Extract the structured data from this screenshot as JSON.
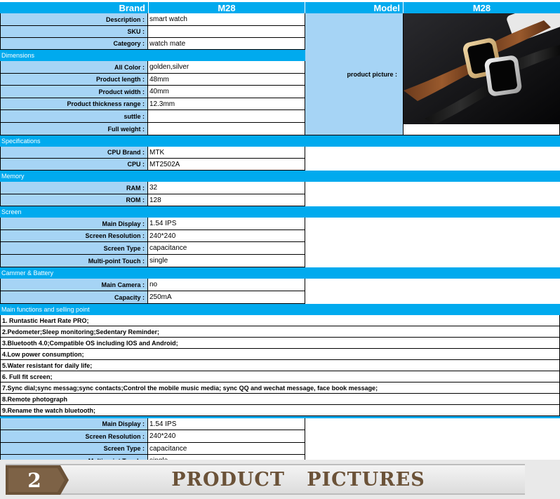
{
  "header": {
    "brand_label": "Brand",
    "brand_value": "M28",
    "model_label": "Model",
    "model_value": "M28"
  },
  "basic": [
    {
      "label": "Description :",
      "value": "smart watch"
    },
    {
      "label": "SKU :",
      "value": ""
    },
    {
      "label": "Category :",
      "value": "watch mate"
    }
  ],
  "picture_label": "product picture :",
  "sections": {
    "dimensions": "Dimensions",
    "specifications": "Specifications",
    "memory": "Memory",
    "screen": "Screen",
    "camera_battery": "Cammer & Battery",
    "main_functions": "Main functions and selling point"
  },
  "dimensions": [
    {
      "label": "All Color :",
      "value": "golden,silver"
    },
    {
      "label": "Product length :",
      "value": "48mm"
    },
    {
      "label": "Product width :",
      "value": "40mm"
    },
    {
      "label": "Product thickness range :",
      "value": "12.3mm"
    },
    {
      "label": "suttle :",
      "value": ""
    },
    {
      "label": "Full weight :",
      "value": ""
    }
  ],
  "specifications": [
    {
      "label": "CPU Brand :",
      "value": "MTK"
    },
    {
      "label": "CPU :",
      "value": "MT2502A"
    }
  ],
  "memory": [
    {
      "label": "RAM :",
      "value": "32"
    },
    {
      "label": "ROM :",
      "value": "128"
    }
  ],
  "screen": [
    {
      "label": "Main Display :",
      "value": "1.54 IPS"
    },
    {
      "label": "Screen Resolution :",
      "value": "240*240"
    },
    {
      "label": "Screen Type :",
      "value": "capacitance"
    },
    {
      "label": "Multi-point Touch :",
      "value": "single"
    }
  ],
  "camera_battery": [
    {
      "label": "Main Camera :",
      "value": "no"
    },
    {
      "label": "Capacity :",
      "value": "250mA"
    }
  ],
  "features": [
    "1. Runtastic Heart Rate PRO;",
    "2.Pedometer;Sleep monitoring;Sedentary Reminder;",
    "3.Bluetooth 4.0;Compatible OS including IOS and Android;",
    "4.Low power consumption;",
    "5.Water resistant for daily life;",
    "6. Full fit screen;",
    "7.Sync dial;sync messag;sync contacts;Control the mobile music media; sync QQ and wechat message, face book  message;",
    "8.Remote photograph",
    "9.Rename the watch bluetooth;"
  ],
  "screen_repeat": [
    {
      "label": "Main Display :",
      "value": "1.54 IPS"
    },
    {
      "label": "Screen Resolution :",
      "value": "240*240"
    },
    {
      "label": "Screen Type :",
      "value": "capacitance"
    },
    {
      "label": "Multi-point Touch :",
      "value": "single"
    }
  ],
  "banner": {
    "number": "2",
    "title": "PRODUCT   PICTURES"
  },
  "colors": {
    "header_blue": "#00aaee",
    "label_blue": "#a6d4f5"
  }
}
